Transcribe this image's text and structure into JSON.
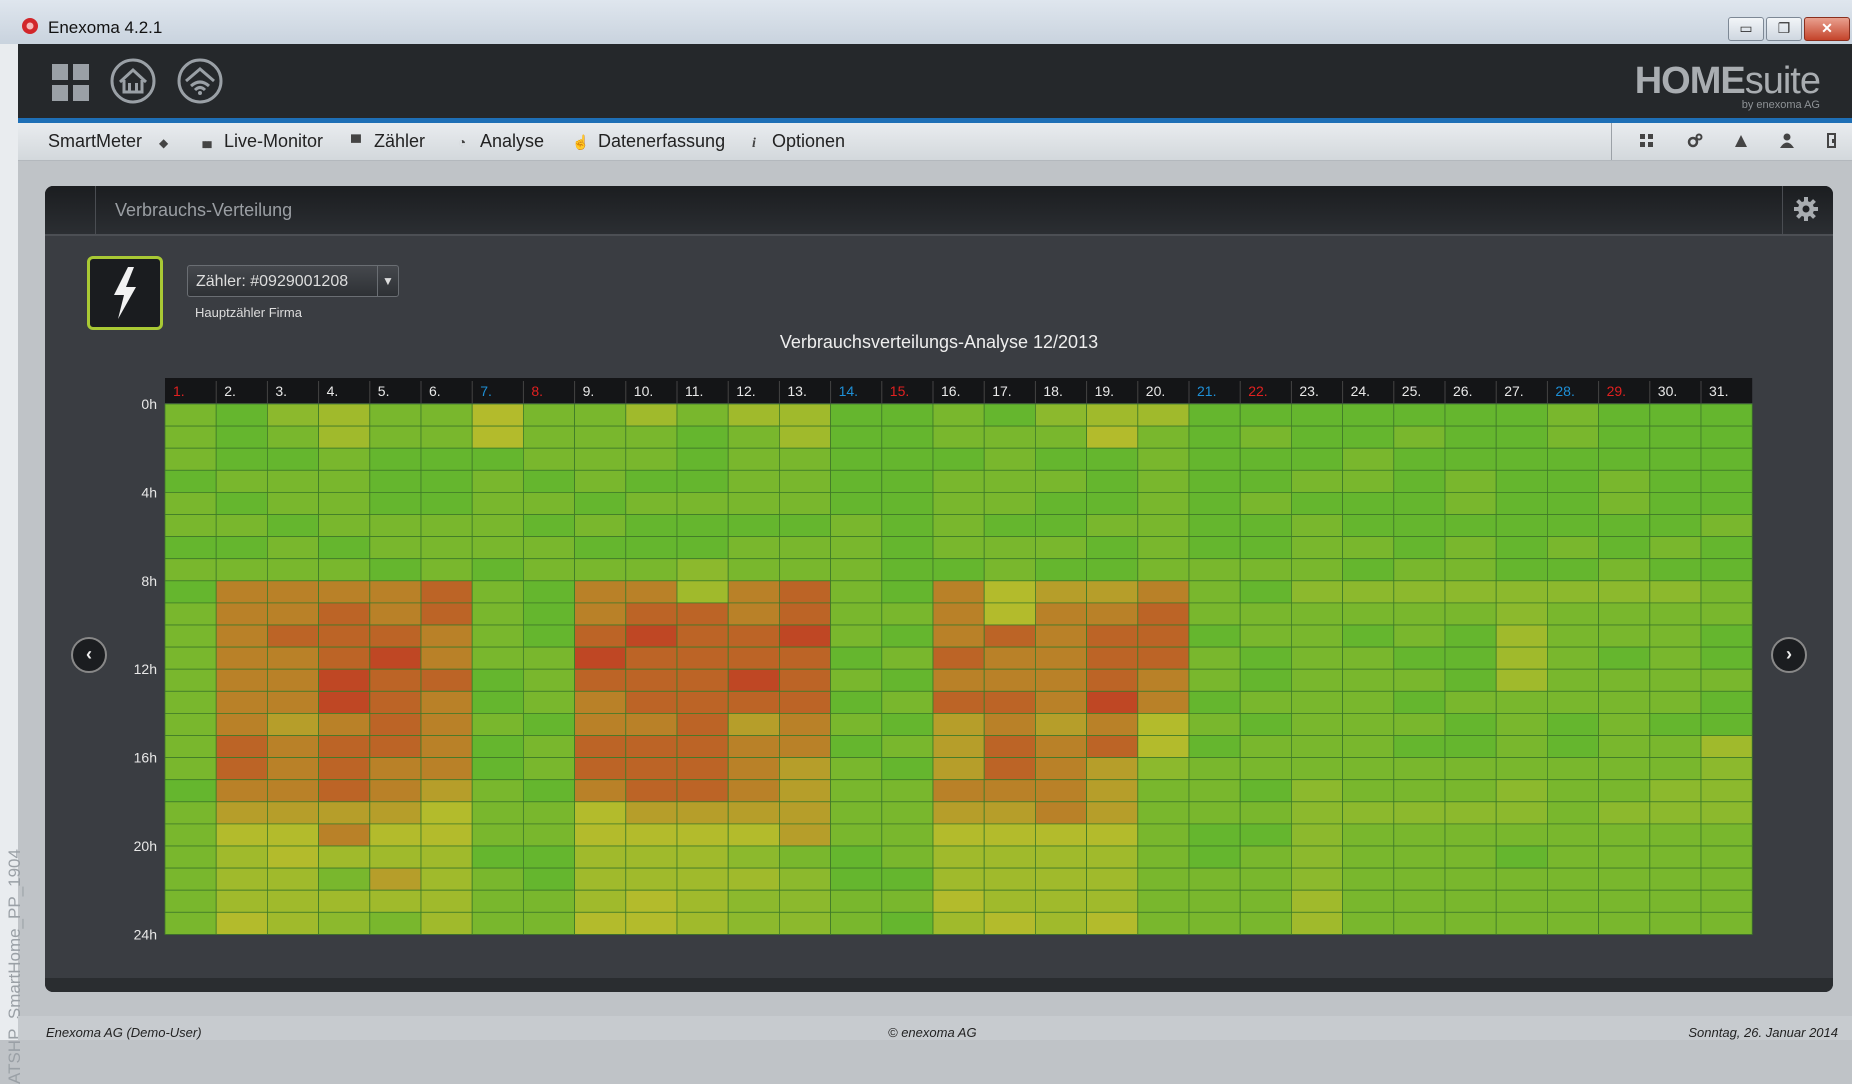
{
  "window": {
    "title": "Enexoma 4.2.1",
    "controls": [
      "▭",
      "❐",
      "✕"
    ]
  },
  "watermark": "ATSHP_SmartHome_PP_1904",
  "header": {
    "icons": [
      "apps-grid-icon",
      "home-icon",
      "smart-home-icon"
    ],
    "brand_main": "HOME",
    "brand_suffix": "suite",
    "brand_sub": "by enexoma AG"
  },
  "nav": {
    "items": [
      {
        "label": "SmartMeter",
        "icon": "",
        "trail": "◆"
      },
      {
        "label": "Live-Monitor",
        "icon": "▮▮▮"
      },
      {
        "label": "Zähler",
        "icon": "▀"
      },
      {
        "label": "Analyse",
        "icon": "◔"
      },
      {
        "label": "Datenerfassung",
        "icon": "☝"
      },
      {
        "label": "Optionen",
        "icon": "i"
      }
    ],
    "right_icons": [
      "modules-icon",
      "settings-icon",
      "warning-icon",
      "user-icon",
      "exit-icon"
    ]
  },
  "panel": {
    "title": "Verbrauchs-Verteilung",
    "meter_select": "Zähler: #0929001208",
    "meter_desc": "Hauptzähler Firma",
    "chart_title": "Verbrauchsverteilungs-Analyse 12/2013"
  },
  "chart_data": {
    "type": "heatmap",
    "title": "Verbrauchsverteilungs-Analyse 12/2013",
    "x_labels": [
      "1.",
      "2.",
      "3.",
      "4.",
      "5.",
      "6.",
      "7.",
      "8.",
      "9.",
      "10.",
      "11.",
      "12.",
      "13.",
      "14.",
      "15.",
      "16.",
      "17.",
      "18.",
      "19.",
      "20.",
      "21.",
      "22.",
      "23.",
      "24.",
      "25.",
      "26.",
      "27.",
      "28.",
      "29.",
      "30.",
      "31."
    ],
    "x_label_types": [
      "h",
      "w",
      "w",
      "w",
      "w",
      "w",
      "s",
      "h",
      "w",
      "w",
      "w",
      "w",
      "w",
      "s",
      "h",
      "w",
      "w",
      "w",
      "w",
      "w",
      "s",
      "h",
      "w",
      "w",
      "w",
      "w",
      "w",
      "s",
      "h",
      "w",
      "w"
    ],
    "y_labels": [
      "0h",
      "4h",
      "8h",
      "12h",
      "16h",
      "20h",
      "24h"
    ],
    "y_tick_hours": [
      0,
      4,
      8,
      12,
      16,
      20,
      24
    ],
    "rows": 24,
    "colors": {
      "weekday": "#222",
      "saturday": "#1e8fd6",
      "holiday": "#e02020"
    },
    "scale": {
      "low": "#52b52e",
      "mid": "#b3bb2c",
      "high": "#c22a22"
    },
    "level_scale": "0 = low consumption (green), 10 = high consumption (red)",
    "values": [
      [
        2,
        1,
        3,
        4,
        2,
        2,
        5,
        2,
        2,
        4,
        2,
        4,
        4,
        1,
        1,
        2,
        1,
        3,
        4,
        4,
        1,
        1,
        1,
        1,
        1,
        1,
        1,
        2,
        1,
        1,
        1
      ],
      [
        2,
        1,
        2,
        4,
        2,
        2,
        5,
        2,
        2,
        2,
        1,
        2,
        4,
        1,
        1,
        2,
        2,
        2,
        5,
        2,
        1,
        2,
        1,
        1,
        2,
        1,
        1,
        2,
        1,
        1,
        1
      ],
      [
        2,
        1,
        1,
        2,
        1,
        1,
        1,
        2,
        2,
        2,
        1,
        2,
        2,
        1,
        1,
        1,
        2,
        1,
        1,
        2,
        1,
        1,
        1,
        2,
        1,
        1,
        1,
        1,
        1,
        1,
        1
      ],
      [
        1,
        2,
        2,
        2,
        1,
        1,
        2,
        1,
        2,
        1,
        1,
        2,
        2,
        1,
        1,
        2,
        2,
        2,
        1,
        2,
        1,
        1,
        2,
        2,
        1,
        2,
        1,
        1,
        2,
        1,
        1
      ],
      [
        2,
        1,
        2,
        2,
        1,
        1,
        2,
        2,
        1,
        2,
        2,
        2,
        2,
        1,
        1,
        2,
        2,
        1,
        1,
        2,
        1,
        2,
        1,
        1,
        1,
        2,
        1,
        1,
        2,
        1,
        1
      ],
      [
        2,
        2,
        1,
        2,
        2,
        2,
        2,
        1,
        2,
        1,
        1,
        1,
        1,
        2,
        1,
        2,
        1,
        1,
        2,
        2,
        1,
        1,
        2,
        1,
        1,
        1,
        1,
        1,
        1,
        1,
        2
      ],
      [
        1,
        1,
        2,
        1,
        2,
        2,
        2,
        2,
        1,
        1,
        1,
        2,
        2,
        2,
        1,
        2,
        2,
        2,
        1,
        2,
        1,
        1,
        2,
        2,
        1,
        2,
        1,
        2,
        1,
        2,
        1
      ],
      [
        2,
        2,
        2,
        2,
        1,
        2,
        1,
        2,
        2,
        2,
        3,
        2,
        2,
        2,
        1,
        1,
        2,
        1,
        1,
        2,
        2,
        2,
        2,
        1,
        2,
        2,
        1,
        1,
        2,
        1,
        1
      ],
      [
        1,
        7,
        7,
        7,
        7,
        8,
        2,
        1,
        7,
        7,
        4,
        7,
        8,
        2,
        1,
        7,
        5,
        6,
        6,
        7,
        2,
        1,
        3,
        3,
        3,
        3,
        3,
        3,
        3,
        3,
        2
      ],
      [
        2,
        7,
        7,
        8,
        7,
        8,
        2,
        1,
        7,
        8,
        8,
        7,
        8,
        2,
        2,
        7,
        5,
        7,
        7,
        8,
        2,
        2,
        2,
        2,
        2,
        2,
        3,
        2,
        2,
        2,
        2
      ],
      [
        2,
        7,
        8,
        8,
        8,
        7,
        2,
        1,
        8,
        9,
        8,
        8,
        9,
        2,
        1,
        7,
        8,
        7,
        8,
        8,
        1,
        2,
        2,
        1,
        2,
        1,
        4,
        2,
        2,
        2,
        1
      ],
      [
        2,
        7,
        7,
        8,
        9,
        7,
        2,
        2,
        9,
        8,
        8,
        8,
        8,
        1,
        2,
        8,
        7,
        7,
        8,
        8,
        2,
        1,
        2,
        2,
        1,
        1,
        4,
        2,
        1,
        2,
        1
      ],
      [
        2,
        7,
        7,
        9,
        8,
        8,
        1,
        2,
        8,
        8,
        8,
        9,
        8,
        2,
        1,
        7,
        7,
        7,
        8,
        7,
        2,
        1,
        2,
        2,
        2,
        1,
        4,
        2,
        2,
        2,
        2
      ],
      [
        2,
        7,
        7,
        9,
        8,
        7,
        1,
        2,
        7,
        8,
        8,
        8,
        8,
        1,
        2,
        8,
        8,
        7,
        9,
        7,
        1,
        2,
        2,
        2,
        1,
        2,
        2,
        2,
        2,
        2,
        1
      ],
      [
        2,
        7,
        6,
        7,
        8,
        7,
        2,
        1,
        7,
        7,
        8,
        6,
        7,
        2,
        1,
        6,
        7,
        6,
        7,
        5,
        2,
        1,
        2,
        2,
        2,
        1,
        2,
        1,
        2,
        1,
        1
      ],
      [
        2,
        8,
        7,
        8,
        8,
        7,
        1,
        2,
        8,
        8,
        8,
        7,
        7,
        1,
        2,
        6,
        8,
        7,
        8,
        5,
        1,
        2,
        2,
        2,
        1,
        1,
        2,
        1,
        2,
        2,
        4
      ],
      [
        2,
        8,
        7,
        8,
        7,
        7,
        1,
        2,
        8,
        8,
        8,
        7,
        6,
        2,
        1,
        6,
        8,
        7,
        6,
        3,
        2,
        2,
        2,
        2,
        2,
        2,
        2,
        2,
        2,
        2,
        3
      ],
      [
        1,
        7,
        7,
        8,
        7,
        6,
        2,
        1,
        7,
        8,
        8,
        7,
        6,
        2,
        2,
        7,
        7,
        7,
        6,
        2,
        2,
        1,
        3,
        2,
        2,
        2,
        3,
        2,
        2,
        3,
        3
      ],
      [
        2,
        6,
        6,
        6,
        6,
        5,
        2,
        2,
        5,
        6,
        6,
        6,
        6,
        2,
        2,
        6,
        6,
        7,
        6,
        2,
        2,
        2,
        3,
        3,
        3,
        3,
        3,
        2,
        3,
        3,
        3
      ],
      [
        2,
        5,
        5,
        7,
        5,
        5,
        2,
        2,
        5,
        5,
        5,
        5,
        6,
        2,
        2,
        5,
        5,
        5,
        5,
        2,
        1,
        1,
        3,
        2,
        2,
        2,
        2,
        2,
        2,
        2,
        2
      ],
      [
        2,
        4,
        5,
        4,
        4,
        4,
        1,
        1,
        4,
        4,
        4,
        3,
        2,
        1,
        2,
        4,
        4,
        4,
        4,
        2,
        1,
        2,
        3,
        2,
        2,
        2,
        1,
        2,
        2,
        2,
        2
      ],
      [
        2,
        4,
        4,
        2,
        6,
        4,
        2,
        1,
        4,
        4,
        4,
        4,
        3,
        1,
        1,
        4,
        4,
        4,
        4,
        2,
        2,
        2,
        3,
        2,
        2,
        2,
        2,
        2,
        2,
        2,
        2
      ],
      [
        2,
        4,
        4,
        4,
        4,
        4,
        2,
        2,
        4,
        5,
        4,
        3,
        3,
        2,
        2,
        5,
        4,
        4,
        4,
        2,
        2,
        2,
        4,
        2,
        2,
        2,
        2,
        2,
        2,
        2,
        2
      ],
      [
        2,
        5,
        4,
        3,
        2,
        4,
        2,
        2,
        5,
        5,
        4,
        3,
        3,
        2,
        1,
        4,
        5,
        4,
        5,
        2,
        2,
        2,
        4,
        2,
        2,
        2,
        2,
        2,
        2,
        2,
        2
      ]
    ]
  },
  "footer": {
    "left": "Enexoma AG (Demo-User)",
    "center": "© enexoma AG",
    "right": "Sonntag, 26. Januar 2014"
  }
}
